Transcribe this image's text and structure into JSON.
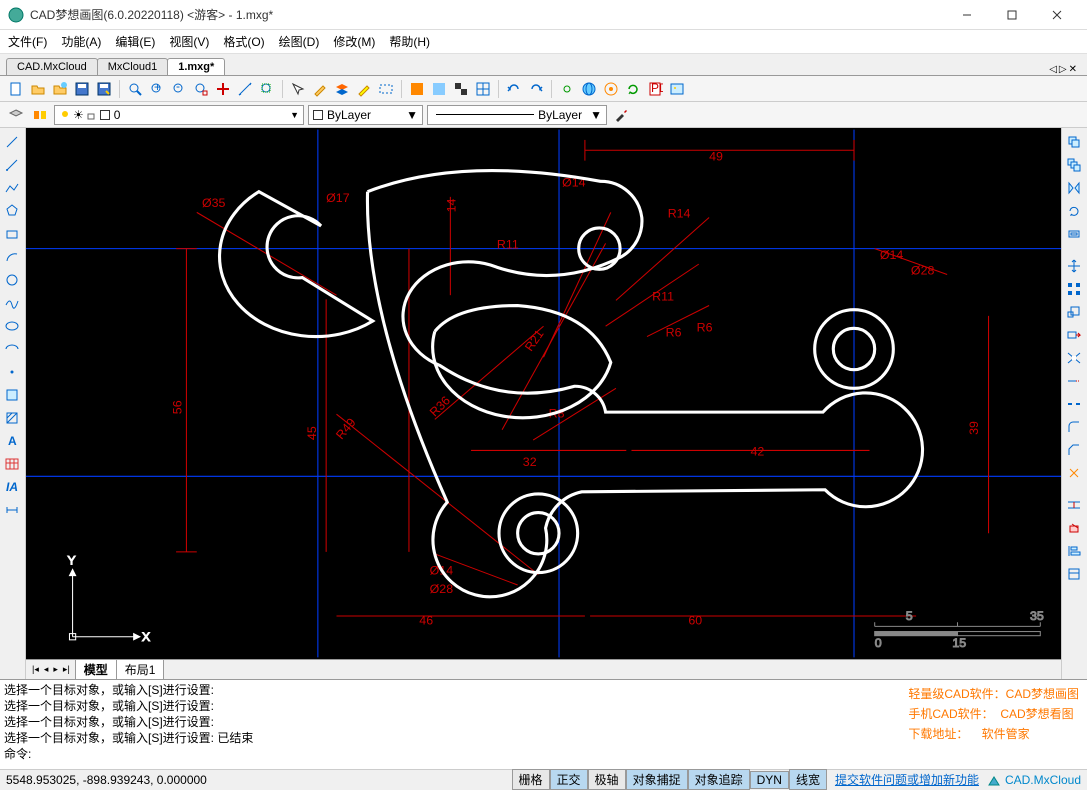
{
  "window": {
    "title": "CAD梦想画图(6.0.20220118) <游客> - 1.mxg*"
  },
  "menu": {
    "file": "文件(F)",
    "func": "功能(A)",
    "edit": "编辑(E)",
    "view": "视图(V)",
    "format": "格式(O)",
    "draw": "绘图(D)",
    "modify": "修改(M)",
    "help": "帮助(H)"
  },
  "tabs": {
    "t1": "CAD.MxCloud",
    "t2": "MxCloud1",
    "t3": "1.mxg*"
  },
  "layer": {
    "current": "0",
    "color": "ByLayer",
    "linetype": "ByLayer"
  },
  "layout": {
    "model": "模型",
    "layout1": "布局1"
  },
  "cmd": {
    "l1": "选择一个目标对象，或输入[S]进行设置:",
    "l2": "选择一个目标对象，或输入[S]进行设置:",
    "l3": "选择一个目标对象，或输入[S]进行设置:",
    "l4": "选择一个目标对象，或输入[S]进行设置:   已结束",
    "prompt": "命令:"
  },
  "promo": {
    "l1a": "轻量级CAD软件：",
    "l1b": "CAD梦想画图",
    "l2a": "手机CAD软件：",
    "l2b": "CAD梦想看图",
    "l3a": "下载地址：",
    "l3b": "软件管家"
  },
  "status": {
    "coords": "5548.953025,  -898.939243,  0.000000",
    "grid": "栅格",
    "ortho": "正交",
    "polar": "极轴",
    "osnap": "对象捕捉",
    "otrack": "对象追踪",
    "dyn": "DYN",
    "lwt": "线宽",
    "feedback": "提交软件问题或增加新功能",
    "brand": "CAD.MxCloud"
  },
  "dims": {
    "d35": "Ø35",
    "d17": "Ø17",
    "d14a": "Ø14",
    "d14b": "Ø14",
    "d14c": "Ø14",
    "d28a": "Ø28",
    "d28b": "Ø28",
    "r11a": "R11",
    "r11b": "R11",
    "r14": "R14",
    "r21": "R21",
    "r36": "R36",
    "r49v": "R49",
    "r6a": "R6",
    "r6b": "R6",
    "r8": "R8",
    "h14": "14",
    "h49": "49",
    "h42": "42",
    "h46": "46",
    "h60": "60",
    "h32": "32",
    "v56": "56",
    "v45": "45",
    "v39": "39"
  },
  "scale": {
    "s5": "5",
    "s35": "35",
    "s0": "0",
    "s15": "15"
  }
}
